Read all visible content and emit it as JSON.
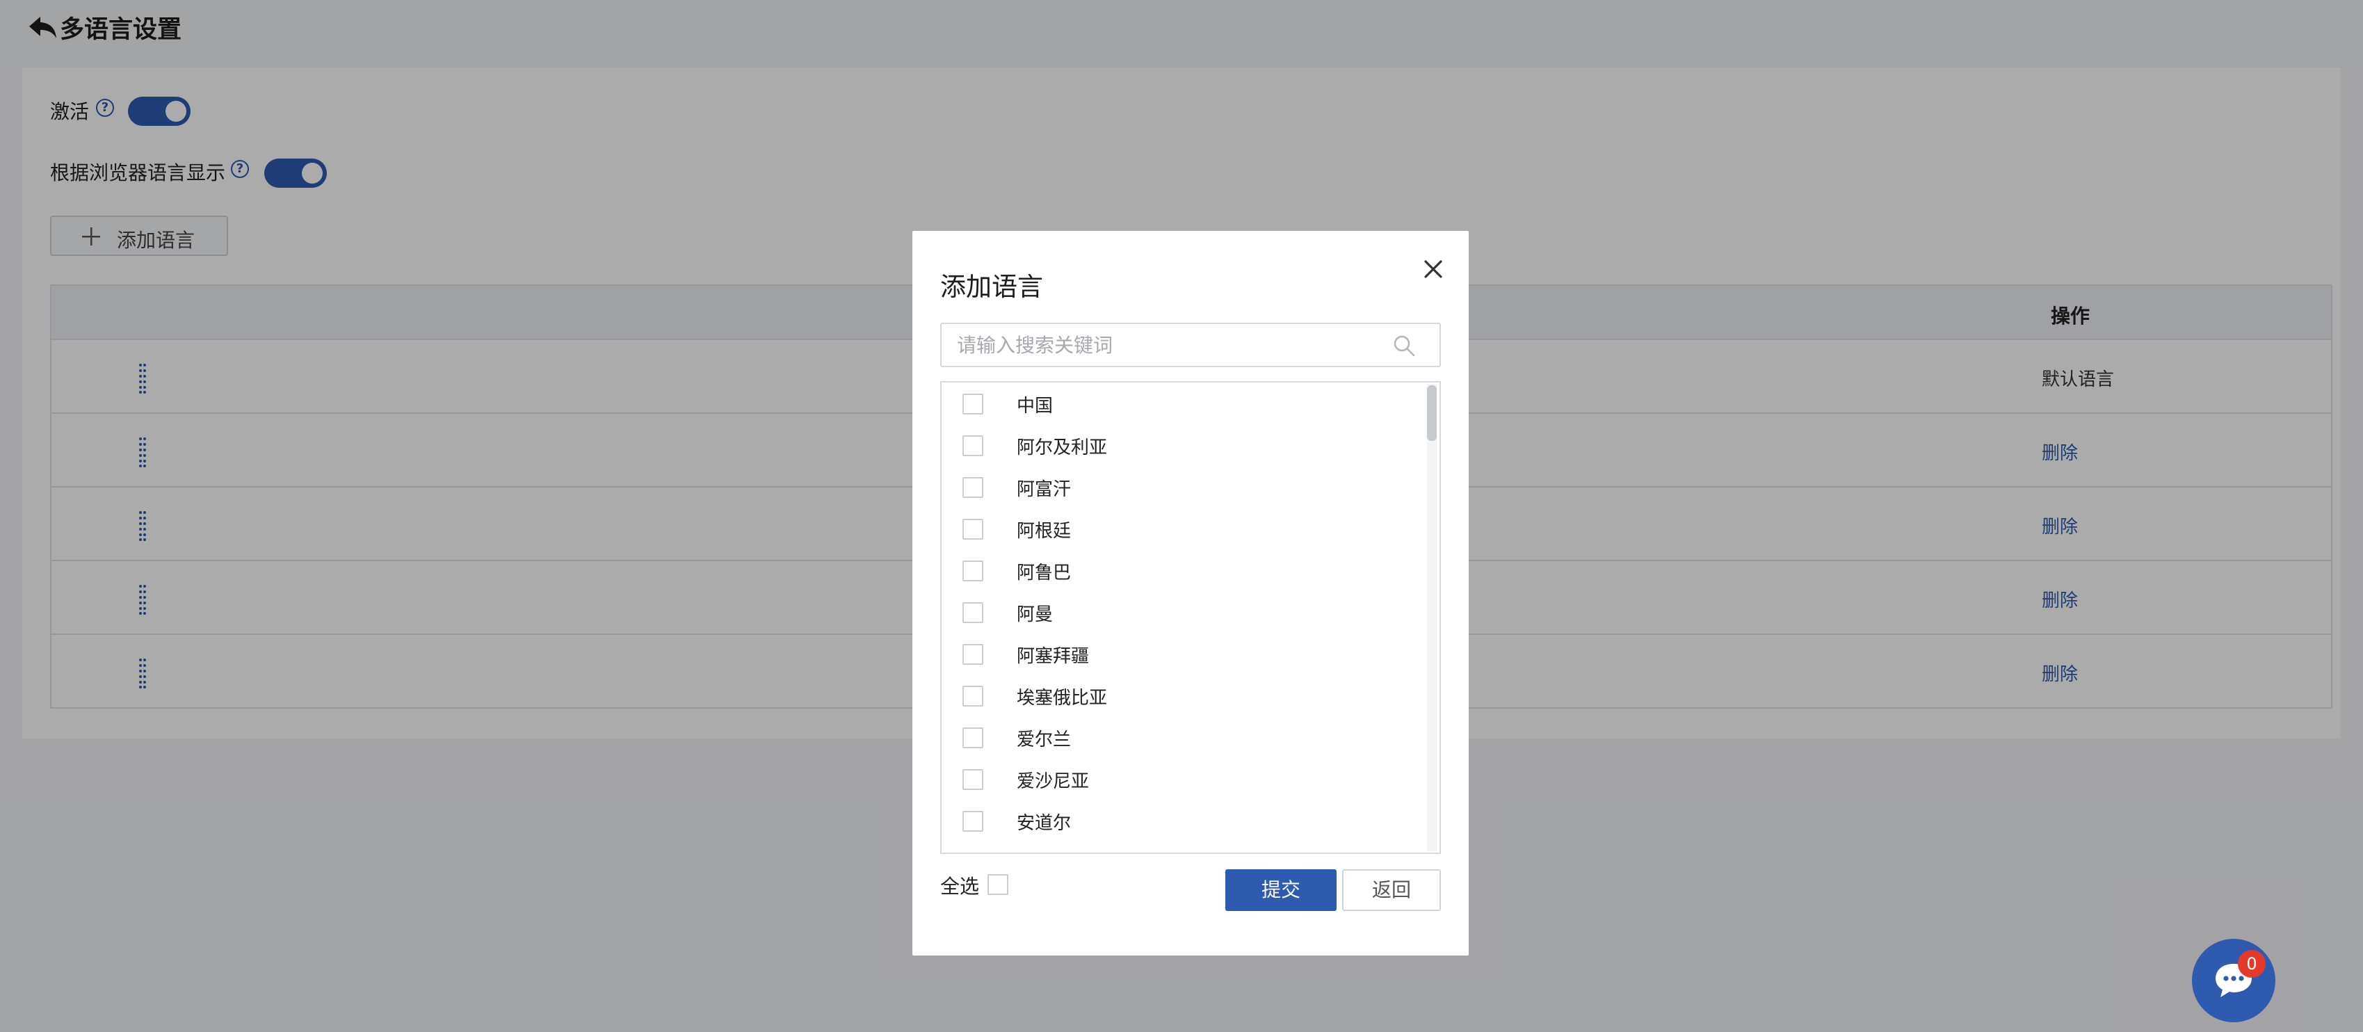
{
  "page": {
    "title": "多语言设置",
    "activate_label": "激活",
    "browser_lang_label": "根据浏览器语言显示",
    "help_glyph": "?",
    "add_language_label": "添加语言"
  },
  "table": {
    "action_header": "操作",
    "rows": [
      {
        "action": "默认语言"
      },
      {
        "action": "删除"
      },
      {
        "action": "删除"
      },
      {
        "action": "删除"
      },
      {
        "action": "删除"
      }
    ]
  },
  "dialog": {
    "title": "添加语言",
    "search_placeholder": "请输入搜索关键词",
    "items": [
      "中国",
      "阿尔及利亚",
      "阿富汗",
      "阿根廷",
      "阿鲁巴",
      "阿曼",
      "阿塞拜疆",
      "埃塞俄比亚",
      "爱尔兰",
      "爱沙尼亚",
      "安道尔"
    ],
    "select_all_label": "全选",
    "submit_label": "提交",
    "back_label": "返回"
  },
  "chat": {
    "badge_count": "0"
  },
  "colors": {
    "primary": "#2e5bb0",
    "badge": "#e33a2c"
  }
}
